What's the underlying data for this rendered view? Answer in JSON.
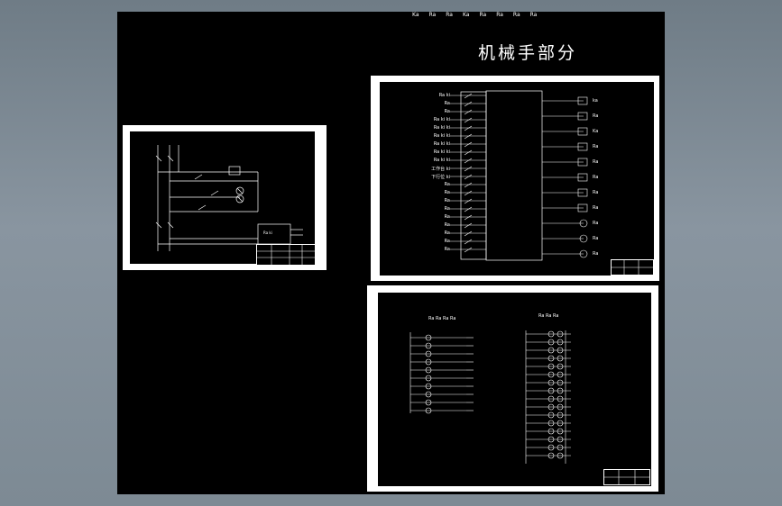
{
  "drawing": {
    "title": "机械手部分",
    "top_labels": [
      "Ka",
      "Ra",
      "Ra",
      "Ka",
      "Ra",
      "Ra",
      "Ra",
      "Ra"
    ],
    "colors": {
      "background": "#000000",
      "line": "#ffffff",
      "frame": "#ffffff",
      "viewport": "#7d8a94"
    },
    "left_sheet": {
      "kind": "wiring-schematic",
      "device_label": "Ra ki"
    },
    "plc_sheet": {
      "kind": "plc-io-diagram",
      "input_labels": [
        "Ra ki",
        "Ra",
        "Ra",
        "Ra ki ki",
        "Ra ki ki",
        "Ra ki ki",
        "Ra ki ki",
        "Ra ki ki",
        "Ra ki ki",
        "工作台 ki",
        "下行位 ki",
        "Ra",
        "Ra",
        "Ra",
        "Ra",
        "Ra",
        "Ra",
        "Ra",
        "Ra",
        "Ra"
      ],
      "output_labels": [
        "Ra",
        "Ra",
        "Ra",
        "Ra",
        "Ra",
        "Ra",
        "Ra",
        "Ra",
        "Ra",
        "Ra",
        "Ra"
      ],
      "side_labels": [
        "ka",
        "Ra",
        "Ka",
        "Ra",
        "Ra",
        "Ra",
        "Ra",
        "Ra",
        "Ra",
        "Ra",
        "Ra"
      ]
    },
    "ladder_sheet": {
      "kind": "ladder-diagram",
      "left_heading": "Ra Ra Ra Ra",
      "right_heading": "Ra Ra Ra"
    }
  }
}
